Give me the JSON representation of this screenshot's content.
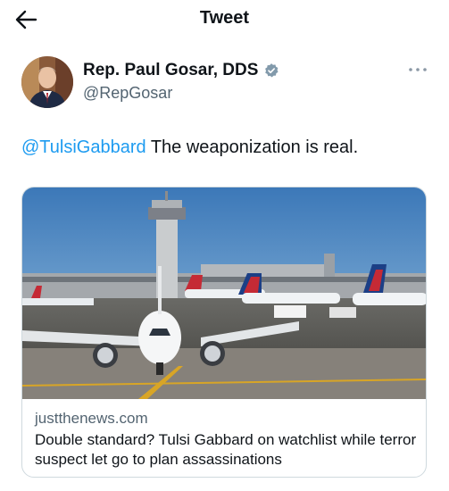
{
  "header": {
    "title": "Tweet",
    "back_icon": "arrow-left-icon"
  },
  "author": {
    "name": "Rep. Paul Gosar, DDS",
    "handle": "@RepGosar",
    "verified_icon": "verified-badge-icon",
    "avatar_icon": "profile-photo"
  },
  "more_icon": "ellipsis-icon",
  "tweet": {
    "mention": "@TulsiGabbard",
    "text": " The weaponization is real."
  },
  "card": {
    "image_icon": "airport-tarmac-photo",
    "domain": "justthenews.com",
    "title": "Double standard? Tulsi Gabbard on watchlist while terror suspect let go to plan assassinations"
  },
  "colors": {
    "accent": "#1d9bf0",
    "text": "#0f1419",
    "secondary": "#536471",
    "border": "#cfd9de"
  }
}
